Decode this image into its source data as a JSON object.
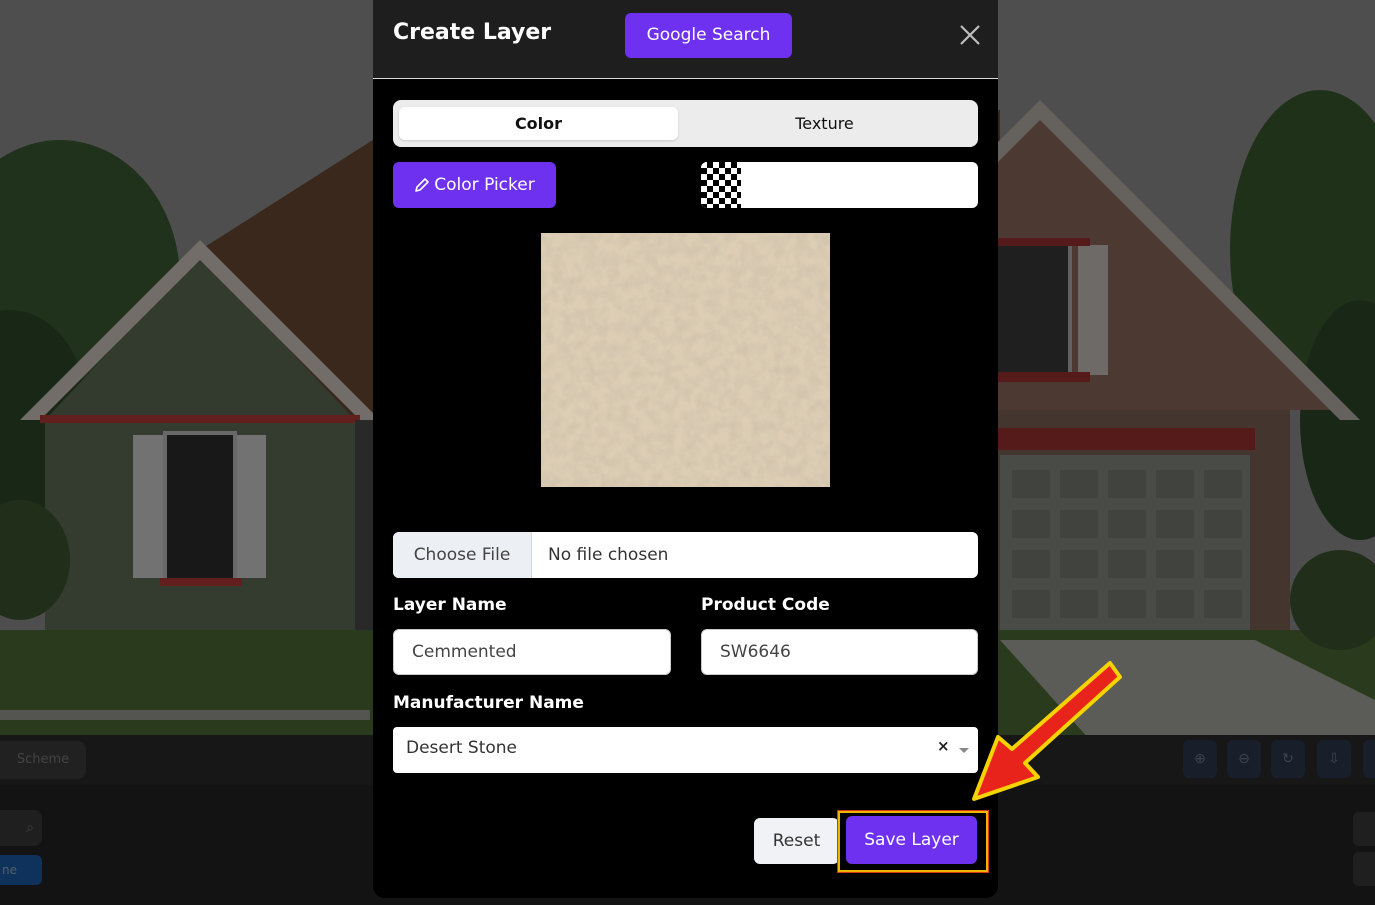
{
  "modal": {
    "title": "Create Layer",
    "google_search_label": "Google Search",
    "tabs": [
      {
        "label": "Color",
        "active": true
      },
      {
        "label": "Texture",
        "active": false
      }
    ],
    "color_picker_label": "Color Picker",
    "file": {
      "button_label": "Choose File",
      "status_text": "No file chosen"
    },
    "layer_name": {
      "label": "Layer Name",
      "value": "Cemmented"
    },
    "product_code": {
      "label": "Product Code",
      "value": "SW6646"
    },
    "manufacturer": {
      "label": "Manufacturer Name",
      "value": "Desert Stone",
      "clear_symbol": "×"
    },
    "reset_label": "Reset",
    "save_label": "Save Layer"
  },
  "background": {
    "scheme_label": "Scheme",
    "side_blue_label": "ne"
  },
  "colors": {
    "accent": "#6e31f0",
    "highlight_border": "#f1b400",
    "arrow_fill": "#e8231b",
    "arrow_outline": "#f5d300"
  }
}
